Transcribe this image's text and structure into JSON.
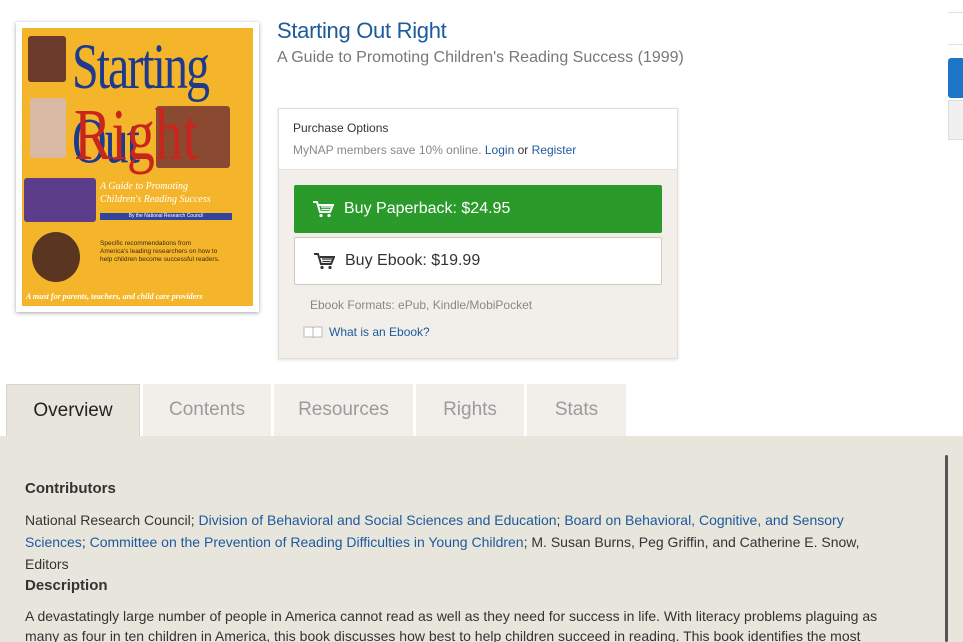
{
  "cover": {
    "title_line1": "Starting Out",
    "title_line2": "Right",
    "subtitle": "A Guide to Promoting Children's Reading Success",
    "byline": "By the National Research Council",
    "recommendation": "Specific recommendations from America's leading researchers on how to help children become successful readers.",
    "footer": "A must for parents, teachers, and child care providers"
  },
  "book": {
    "title": "Starting Out Right",
    "subtitle": "A Guide to Promoting Children's Reading Success",
    "year": "(1999)"
  },
  "purchase": {
    "heading": "Purchase Options",
    "member_note": "MyNAP members save 10% online.",
    "login_label": "Login",
    "or_label": "or",
    "register_label": "Register",
    "paperback_label": "Buy Paperback: $24.95",
    "ebook_label": "Buy Ebook: $19.99",
    "formats": "Ebook Formats: ePub, Kindle/MobiPocket",
    "what_is_ebook": "What is an Ebook?"
  },
  "tabs": [
    {
      "label": "Overview"
    },
    {
      "label": "Contents"
    },
    {
      "label": "Resources"
    },
    {
      "label": "Rights"
    },
    {
      "label": "Stats"
    }
  ],
  "overview": {
    "contributors_heading": "Contributors",
    "contrib_prefix": "National Research Council;",
    "contrib_link1": "Division of Behavioral and Social Sciences and Education",
    "contrib_link2": "Board on Behavioral, Cognitive, and Sensory Sciences",
    "contrib_link3": "Committee on the Prevention of Reading Difficulties in Young Children",
    "contrib_suffix": "; M. Susan Burns, Peg Griffin, and Catherine E. Snow, Editors",
    "description_heading": "Description",
    "description_text": "A devastatingly large number of people in America cannot read as well as they need for success in life. With literacy problems plaguing as many as four in ten children in America, this book discusses how best to help children succeed in reading. This book identifies the most important questions and"
  },
  "colors": {
    "link": "#1c5a9c",
    "buy_green": "#2a9b2a",
    "panel_bg": "#e8e5dd"
  }
}
